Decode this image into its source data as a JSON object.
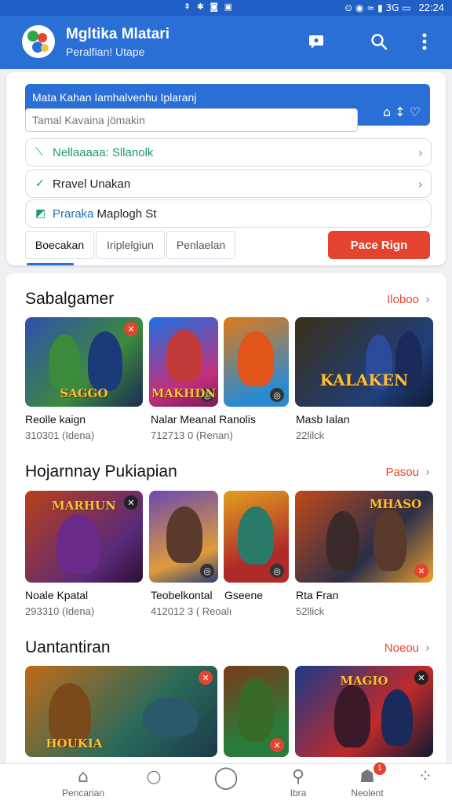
{
  "status": {
    "icons": "⇞ ✱ ◙ ▣",
    "right_icons": "⊙ ◉ ≈ ▮ 3G ▭",
    "time": "22:24"
  },
  "app": {
    "title": "Mgltika Mlatari",
    "subtitle": "Peralfian! Utape",
    "chat_icon": "chat-icon",
    "search_icon": "search-icon",
    "menu_icon": "more-vert-icon"
  },
  "search": {
    "header_text": "Mata Kahan Iamhalvenhu Iplaranj",
    "placeholder": "Tamal Kavaina jömakin",
    "header_icons": "⌂ ↕ ♡",
    "rows": [
      {
        "icon": "⟍",
        "label": "Nellaaaaa: Sllanolk",
        "color": "#1a9a6a"
      },
      {
        "icon": "✓",
        "label": "Rravel Unakan",
        "color": "#333"
      },
      {
        "icon": "◩",
        "label": "Praraka",
        "label2": "Maplogh St",
        "color": "#1e6fb8"
      }
    ],
    "tabs": [
      "Boecakan",
      "Iriplelgiun",
      "Penlaelan"
    ],
    "action_button": "Pace Rign"
  },
  "sections": [
    {
      "title": "Sabalgamer",
      "see_all": "Iloboo",
      "games": [
        {
          "name": "Reolle kaign",
          "meta": "310301 (Idena)",
          "art": "SAGGO",
          "colors": [
            "#2f4fb0",
            "#3c8a3c",
            "#e4432f"
          ]
        },
        {
          "name": "Nalar Meanal Ranolis",
          "meta": "712713 0 (Renan)",
          "art": "MAKHDN",
          "colors": [
            "#1f6fe0",
            "#c22f7a",
            "#f0b020"
          ]
        },
        {
          "name": "",
          "meta": "",
          "art": "",
          "colors": [
            "#e07a18",
            "#2a8ad0",
            "#f2c23a"
          ]
        },
        {
          "name": "Masb Ialan",
          "meta": "22lilck",
          "art": "KALAKEN",
          "colors": [
            "#3a2f18",
            "#1f3f7a",
            "#e8b020"
          ]
        }
      ]
    },
    {
      "title": "Hojarnnay Pukiapian",
      "see_all": "Pasou",
      "games": [
        {
          "name": "Noale Kpatal",
          "meta": "293310 (Idena)",
          "art": "MARHUN",
          "colors": [
            "#b8401a",
            "#5a2a7a",
            "#f2c23a"
          ]
        },
        {
          "name": "Teobelkontal",
          "meta": "412012 3 ( Reoalı",
          "art": "",
          "colors": [
            "#6a4ab0",
            "#e09a3a",
            "#2a3f7a"
          ]
        },
        {
          "name": "Gseene",
          "meta": "",
          "art": "",
          "colors": [
            "#e0a020",
            "#b02a2a",
            "#3a6ab0"
          ]
        },
        {
          "name": "Rta Fran",
          "meta": "52llick",
          "art": "MHASO",
          "colors": [
            "#c04a1a",
            "#2a2f4a",
            "#f0a030"
          ]
        }
      ]
    },
    {
      "title": "Uantantiran",
      "see_all": "Noeou",
      "games": [
        {
          "name": "",
          "meta": "",
          "art": "HOUKIA",
          "colors": [
            "#c06a1a",
            "#2a6a5a",
            "#f2c23a"
          ]
        },
        {
          "name": "",
          "meta": "",
          "art": "",
          "colors": [
            "#7a3a1a",
            "#2a7a3a",
            "#e0a020"
          ]
        },
        {
          "name": "",
          "meta": "",
          "art": "MAGIO",
          "colors": [
            "#1a3a8a",
            "#c02a2a",
            "#f0c030"
          ]
        }
      ]
    }
  ],
  "nav": [
    {
      "icon": "⌂",
      "label": "Pencarian"
    },
    {
      "icon": "○",
      "label": ""
    },
    {
      "icon": "◯",
      "label": ""
    },
    {
      "icon": "⚲",
      "label": "Ibra"
    },
    {
      "icon": "☗",
      "label": "Neolent",
      "badge": "1"
    },
    {
      "icon": "⁘",
      "label": ""
    }
  ],
  "colors": {
    "primary": "#2a6fd6",
    "accent": "#e4432f"
  }
}
